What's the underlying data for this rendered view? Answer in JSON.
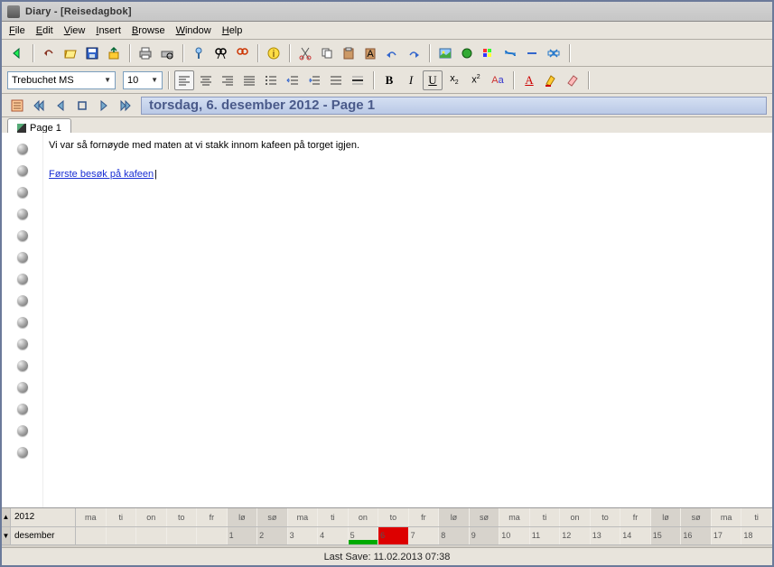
{
  "window": {
    "title": "Diary - [Reisedagbok]"
  },
  "menu": {
    "file": "File",
    "edit": "Edit",
    "view": "View",
    "insert": "Insert",
    "browse": "Browse",
    "window": "Window",
    "help": "Help"
  },
  "font": {
    "name": "Trebuchet MS",
    "size": "10"
  },
  "icons": {
    "back": "back",
    "undo": "undo",
    "open": "open",
    "save": "save",
    "export": "export",
    "print": "print",
    "printpreview": "printpreview",
    "attach": "attach",
    "find": "find",
    "findnext": "findnext",
    "info": "info",
    "cut": "cut",
    "copy": "copy",
    "paste": "paste",
    "pastefmt": "pastefmt",
    "redo": "redo",
    "redo2": "redo2",
    "image": "image",
    "color": "color",
    "palette": "palette",
    "strike": "strike",
    "minus": "minus",
    "clear": "clear",
    "alignl": "alignl",
    "alignc": "alignc",
    "alignr": "alignr",
    "just": "just",
    "bullets": "bullets",
    "indent": "indent",
    "outdent": "outdent",
    "numlist": "numlist",
    "hr": "hr",
    "bold": "B",
    "italic": "I",
    "underline": "U",
    "sub": "x₂",
    "sup": "x²",
    "case": "Aa",
    "fontcolor": "A",
    "hilite": "hilite",
    "eraser": "eraser",
    "nav_cfg": "cfg",
    "first": "first",
    "prev": "prev",
    "today": "today",
    "next": "next",
    "last": "last"
  },
  "header": {
    "date_page": "torsdag, 6. desember 2012 - Page 1"
  },
  "tab": {
    "label": "Page 1"
  },
  "entry": {
    "text": "Vi var så fornøyde med maten at vi stakk innom kafeen på torget igjen.",
    "link": "Første besøk på kafeen"
  },
  "calendar": {
    "year": "2012",
    "month": "desember",
    "weekdays": [
      "ma",
      "ti",
      "on",
      "to",
      "fr",
      "lø",
      "sø",
      "ma",
      "ti",
      "on",
      "to",
      "fr",
      "lø",
      "sø",
      "ma",
      "ti",
      "on",
      "to",
      "fr",
      "lø",
      "sø",
      "ma",
      "ti"
    ],
    "days": [
      "",
      "",
      "",
      "",
      "",
      "",
      "",
      "",
      "",
      "",
      "1",
      "2",
      "3",
      "4",
      "5",
      "6",
      "7",
      "8",
      "9",
      "10",
      "11",
      "12",
      "13",
      "14",
      "15",
      "16",
      "17",
      "18"
    ]
  },
  "status": {
    "lastsave": "Last Save: 11.02.2013 07:38"
  }
}
